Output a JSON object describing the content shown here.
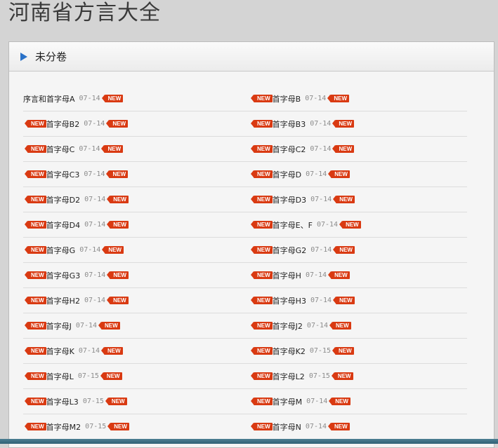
{
  "title": "河南省方言大全",
  "section": {
    "label": "未分卷"
  },
  "badge": "NEW",
  "rows": [
    {
      "left": {
        "name": "序言和首字母A",
        "date": "07-14",
        "pre": false
      },
      "right": {
        "name": "首字母B",
        "date": "07-14",
        "pre": true
      }
    },
    {
      "left": {
        "name": "首字母B2",
        "date": "07-14",
        "pre": true
      },
      "right": {
        "name": "首字母B3",
        "date": "07-14",
        "pre": true
      }
    },
    {
      "left": {
        "name": "首字母C",
        "date": "07-14",
        "pre": true
      },
      "right": {
        "name": "首字母C2",
        "date": "07-14",
        "pre": true
      }
    },
    {
      "left": {
        "name": "首字母C3",
        "date": "07-14",
        "pre": true
      },
      "right": {
        "name": "首字母D",
        "date": "07-14",
        "pre": true
      }
    },
    {
      "left": {
        "name": "首字母D2",
        "date": "07-14",
        "pre": true
      },
      "right": {
        "name": "首字母D3",
        "date": "07-14",
        "pre": true
      }
    },
    {
      "left": {
        "name": "首字母D4",
        "date": "07-14",
        "pre": true
      },
      "right": {
        "name": "首字母E、F",
        "date": "07-14",
        "pre": true
      }
    },
    {
      "left": {
        "name": "首字母G",
        "date": "07-14",
        "pre": true
      },
      "right": {
        "name": "首字母G2",
        "date": "07-14",
        "pre": true
      }
    },
    {
      "left": {
        "name": "首字母G3",
        "date": "07-14",
        "pre": true
      },
      "right": {
        "name": "首字母H",
        "date": "07-14",
        "pre": true
      }
    },
    {
      "left": {
        "name": "首字母H2",
        "date": "07-14",
        "pre": true
      },
      "right": {
        "name": "首字母H3",
        "date": "07-14",
        "pre": true
      }
    },
    {
      "left": {
        "name": "首字母J",
        "date": "07-14",
        "pre": true
      },
      "right": {
        "name": "首字母J2",
        "date": "07-14",
        "pre": true
      }
    },
    {
      "left": {
        "name": "首字母K",
        "date": "07-14",
        "pre": true
      },
      "right": {
        "name": "首字母K2",
        "date": "07-15",
        "pre": true
      }
    },
    {
      "left": {
        "name": "首字母L",
        "date": "07-15",
        "pre": true
      },
      "right": {
        "name": "首字母L2",
        "date": "07-15",
        "pre": true
      }
    },
    {
      "left": {
        "name": "首字母L3",
        "date": "07-15",
        "pre": true
      },
      "right": {
        "name": "首字母M",
        "date": "07-14",
        "pre": true
      }
    },
    {
      "left": {
        "name": "首字母M2",
        "date": "07-15",
        "pre": true
      },
      "right": {
        "name": "首字母N",
        "date": "07-14",
        "pre": true
      }
    }
  ]
}
